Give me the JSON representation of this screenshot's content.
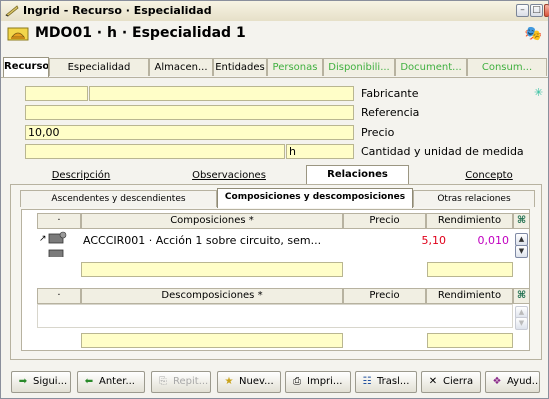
{
  "window": {
    "title": "Ingrid - Recurso · Especialidad"
  },
  "header": {
    "title": "MDO01 · h · Especialidad 1"
  },
  "tabs": [
    {
      "label": "Recurso"
    },
    {
      "label": "Especialidad"
    },
    {
      "label": "Almacen..."
    },
    {
      "label": "Entidades"
    },
    {
      "label": "Personas"
    },
    {
      "label": "Disponibili..."
    },
    {
      "label": "Document..."
    },
    {
      "label": "Consum..."
    }
  ],
  "form": {
    "fabricante_label": "Fabricante",
    "referencia_label": "Referencia",
    "precio_label": "Precio",
    "precio_value": "10,00",
    "cantidad_label": "Cantidad y unidad de medida",
    "unidad_value": "h"
  },
  "subtabs": [
    {
      "label": "Descripción"
    },
    {
      "label": "Observaciones"
    },
    {
      "label": "Relaciones"
    },
    {
      "label": "Concepto"
    }
  ],
  "reltabs": [
    {
      "label": "Ascendentes y descendientes"
    },
    {
      "label": "Composiciones y descomposiciones"
    },
    {
      "label": "Otras relaciones"
    }
  ],
  "composiciones": {
    "dot": "·",
    "header": "Composiciones *",
    "precio_header": "Precio",
    "rendimiento_header": "Rendimiento",
    "rows": [
      {
        "text": "ACCCIR001 · Acción 1 sobre circuito, sem...",
        "precio": "5,10",
        "rendimiento": "0,010"
      }
    ]
  },
  "descomposiciones": {
    "dot": "·",
    "header": "Descomposiciones *",
    "precio_header": "Precio",
    "rendimiento_header": "Rendimiento"
  },
  "buttons": [
    {
      "label": "Sigui...",
      "icon": "arrow-right-icon"
    },
    {
      "label": "Anter...",
      "icon": "arrow-left-icon"
    },
    {
      "label": "Repit...",
      "icon": "repeat-icon"
    },
    {
      "label": "Nuev...",
      "icon": "new-icon"
    },
    {
      "label": "Impri...",
      "icon": "printer-icon"
    },
    {
      "label": "Trasl...",
      "icon": "transfer-icon"
    },
    {
      "label": "Cierra",
      "icon": "close-x-icon"
    },
    {
      "label": "Ayud...",
      "icon": "help-icon"
    }
  ],
  "colors": {
    "field_bg": "#fffec8",
    "green_tab": "#40b040",
    "precio_red": "#e0001a",
    "rend_magenta": "#c000c0"
  }
}
